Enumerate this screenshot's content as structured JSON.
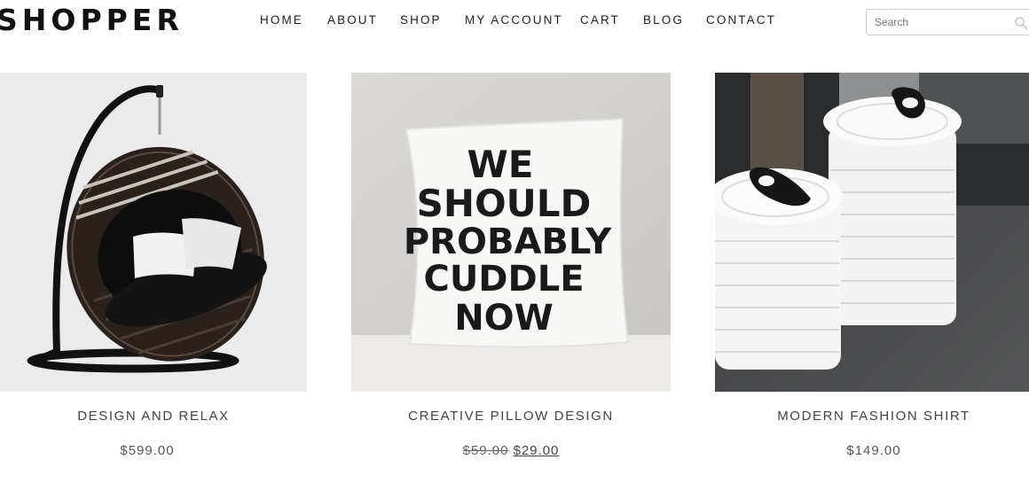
{
  "header": {
    "logo": "SHOPPER",
    "nav": [
      "HOME",
      "ABOUT",
      "SHOP",
      "MY ACCOUNT",
      "CART",
      "BLOG",
      "CONTACT"
    ],
    "search": {
      "placeholder": "Search",
      "icon": "search-icon"
    }
  },
  "products": [
    {
      "title": "DESIGN AND RELAX",
      "price": "$599.00"
    },
    {
      "title": "CREATIVE PILLOW DESIGN",
      "old_price": "$59.00",
      "price": "$29.00"
    },
    {
      "title": "MODERN FASHION SHIRT",
      "price": "$149.00"
    }
  ],
  "pillow_text": [
    "WE",
    "SHOULD",
    "PROBABLY",
    "CUDDLE",
    "NOW"
  ]
}
